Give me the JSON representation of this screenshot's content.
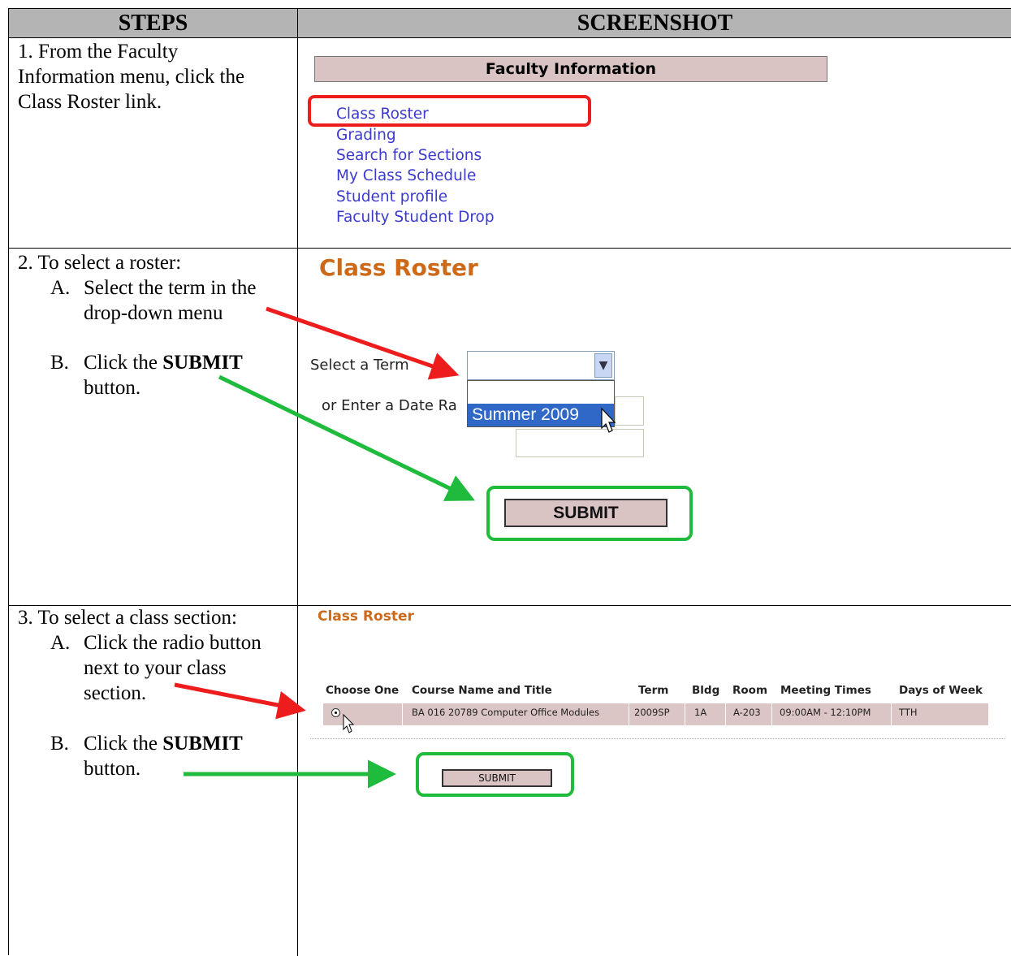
{
  "headers": {
    "steps": "STEPS",
    "screenshot": "SCREENSHOT"
  },
  "step1": {
    "line1": "1.  From the Faculty",
    "line2": "Information menu, click the",
    "line3": "Class Roster link."
  },
  "step2": {
    "line1": "2.  To select a roster:",
    "a_marker": "A.",
    "a_line1": "Select the term in the",
    "a_line2": "drop-down menu",
    "b_marker": "B.",
    "b_pre": "Click the",
    "b_bold": "SUBMIT",
    "b_line2": "button."
  },
  "step3": {
    "line1": "3.  To select a class section:",
    "a_marker": "A.",
    "a_line1": "Click the radio button",
    "a_line2": "next to your class",
    "a_line3": "section.",
    "b_marker": "B.",
    "b_pre": "Click the",
    "b_bold": "SUBMIT",
    "b_line2": "button."
  },
  "faculty_menu": {
    "title": "Faculty Information",
    "links": [
      "Class Roster",
      "Grading",
      "Search for Sections",
      "My Class Schedule",
      "Student profile",
      "Faculty Student Drop"
    ]
  },
  "roster_form": {
    "title": "Class Roster",
    "term_label": "Select a Term",
    "date_label": "or Enter a Date Ra",
    "dropdown_option": "Summer 2009",
    "submit": "SUBMIT"
  },
  "section_form": {
    "title": "Class Roster",
    "columns": [
      "Choose One",
      "Course Name and Title",
      "Term",
      "Bldg",
      "Room",
      "Meeting Times",
      "Days of Week"
    ],
    "row": {
      "course": "BA 016 20789 Computer Office Modules",
      "term": "2009SP",
      "bldg": "1A",
      "room": "A-203",
      "times": "09:00AM - 12:10PM",
      "days": "TTH"
    },
    "submit": "SUBMIT"
  },
  "colors": {
    "highlight_red": "#ee1d1d",
    "highlight_green": "#1fbb3c",
    "title_orange": "#cc6a1a",
    "link_blue": "#3a3ad0"
  }
}
